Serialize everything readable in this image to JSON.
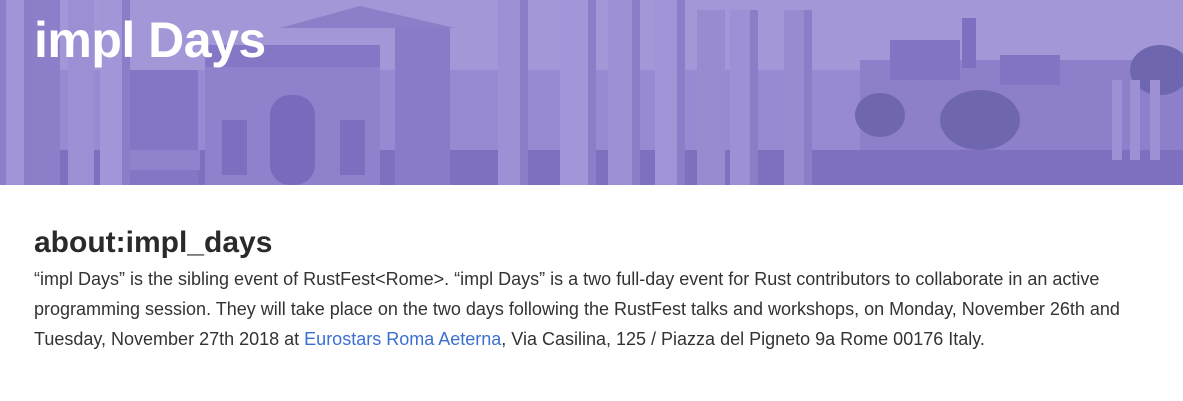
{
  "header": {
    "title": "impl Days"
  },
  "colors": {
    "overlay": "#7a68c8",
    "link": "#3b6fd1",
    "heading": "#2a2a2a",
    "text": "#333333"
  },
  "about": {
    "heading": "about:impl_days",
    "text_before_link": "“impl Days” is the sibling event of RustFest<Rome>. “impl Days” is a two full-day event for Rust contributors to collaborate in an active programming session. They will take place on the two days following the RustFest talks and workshops, on Monday, November 26th and Tuesday, November 27th 2018 at ",
    "link_text": "Eurostars Roma Aeterna",
    "text_after_link": ", Via Casilina, 125 / Piazza del Pigneto 9a Rome 00176 Italy."
  },
  "banner": {
    "icon": "roman-forum-ruins-illustration"
  }
}
